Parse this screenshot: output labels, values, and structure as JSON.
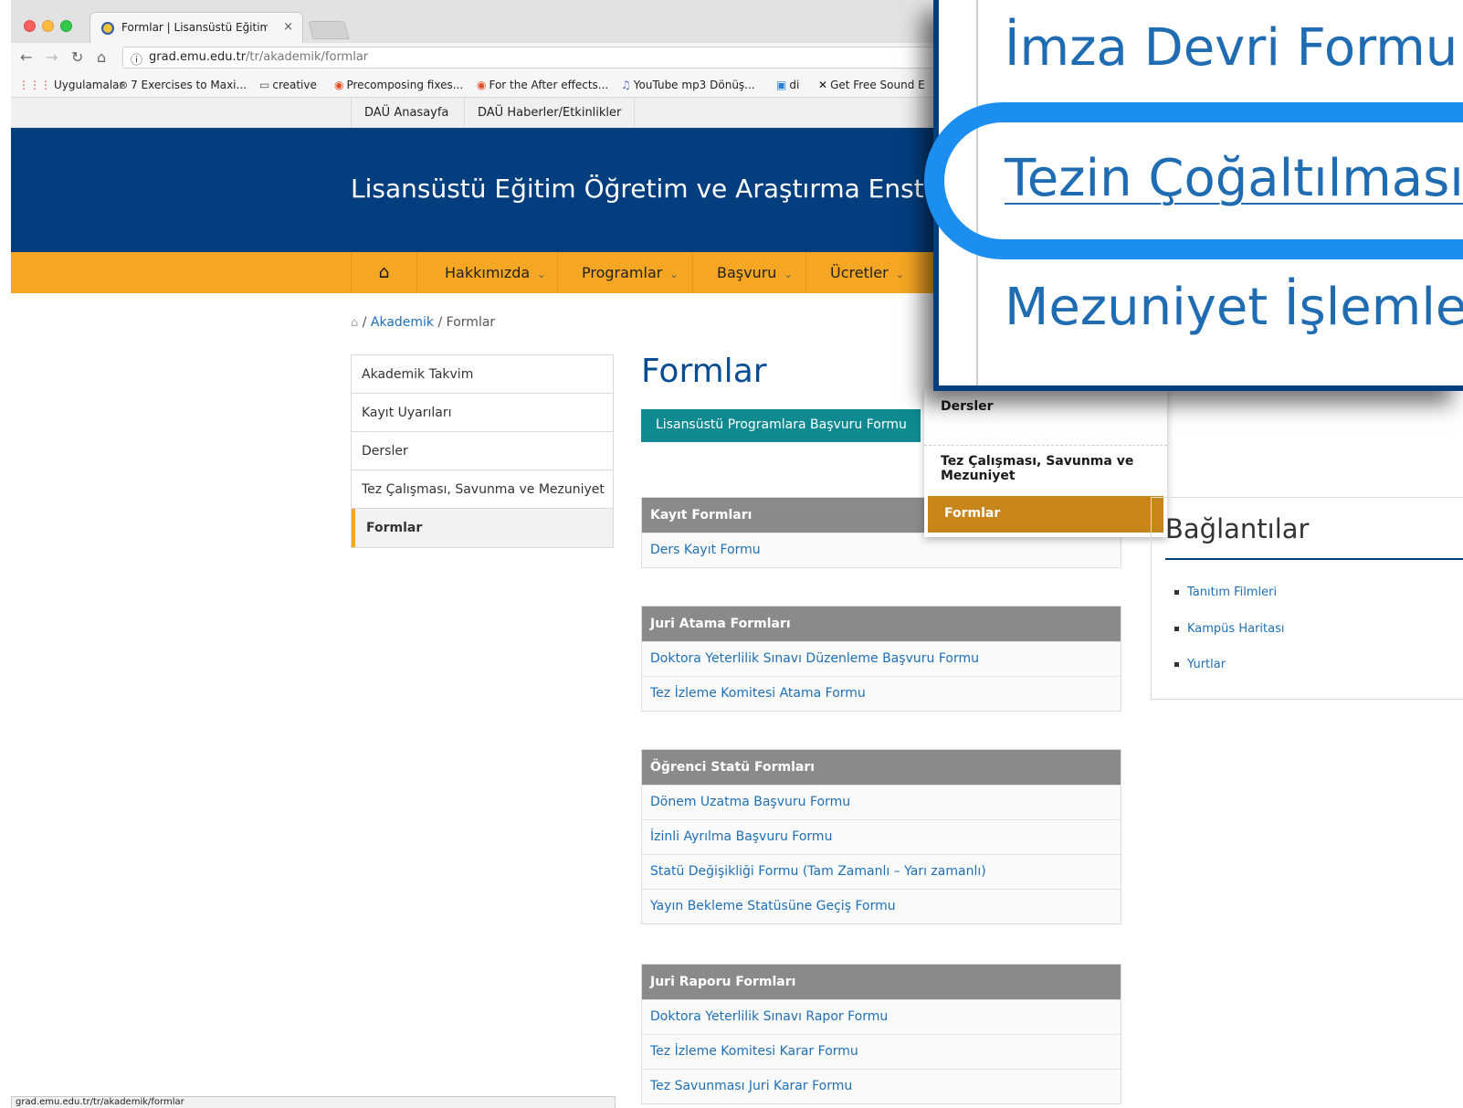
{
  "browser": {
    "tab_title": "Formlar | Lisansüstü Eğitim Öğ",
    "tab_close": "×",
    "url_host": "grad.emu.edu.tr",
    "url_path": "/tr/akademik/formlar",
    "bookmarks": [
      "Uygulamalar",
      "7 Exercises to Maxi...",
      "creative",
      "Precomposing fixes...",
      "For the After effects...",
      "YouTube mp3 Dönüş...",
      "di",
      "Get Free Sound E"
    ],
    "status_url": "grad.emu.edu.tr/tr/akademik/formlar"
  },
  "topbar": {
    "links": [
      "DAÜ Anasayfa",
      "DAÜ Haberler/Etkinlikler"
    ]
  },
  "header": {
    "title": "Lisansüstü Eğitim Öğretim ve Araştırma Enstitü"
  },
  "menu": {
    "items": [
      "Hakkımızda",
      "Programlar",
      "Başvuru",
      "Ücretler"
    ]
  },
  "breadcrumb": {
    "link": "Akademik",
    "current": "Formlar",
    "sep": "/"
  },
  "sidebar": {
    "items": [
      "Akademik Takvim",
      "Kayıt Uyarıları",
      "Dersler",
      "Tez Çalışması, Savunma ve Mezuniyet",
      "Formlar"
    ]
  },
  "main": {
    "title": "Formlar",
    "apply_button": "Lisansüstü Programlara Başvuru Formu",
    "groups": [
      {
        "title": "Kayıt Formları",
        "rows": [
          "Ders Kayıt Formu"
        ]
      },
      {
        "title": "Juri Atama Formları",
        "rows": [
          "Doktora Yeterlilik Sınavı Düzenleme Başvuru Formu",
          "Tez İzleme Komitesi Atama Formu"
        ]
      },
      {
        "title": "Öğrenci Statü Formları",
        "rows": [
          "Dönem Uzatma Başvuru Formu",
          "İzinli Ayrılma Başvuru Formu",
          "Statü Değişikliği Formu (Tam Zamanlı – Yarı zamanlı)",
          "Yayın Bekleme Statüsüne Geçiş Formu"
        ]
      },
      {
        "title": "Juri Raporu Formları",
        "rows": [
          "Doktora Yeterlilik Sınavı Rapor Formu",
          "Tez İzleme Komitesi Karar Formu",
          "Tez Savunması Juri Karar Formu"
        ]
      }
    ]
  },
  "dropdown": {
    "items": [
      "Dersler",
      "Tez Çalışması, Savunma ve Mezuniyet",
      "Formlar"
    ]
  },
  "links": {
    "title": "Bağlantılar",
    "items": [
      "Tanıtım Filmleri",
      "Kampüs Haritası",
      "Yurtlar"
    ]
  },
  "zoom": {
    "lines": [
      "İmza Devri Formu",
      "Tezin Çoğaltılması Y",
      "Mezuniyet İşlemleri"
    ]
  },
  "colors": {
    "brand_blue": "#033e7f",
    "accent_orange": "#f5a623",
    "teal": "#0e8a90",
    "link_blue": "#1e6fb5",
    "highlight_ring": "#1b8ef0"
  }
}
